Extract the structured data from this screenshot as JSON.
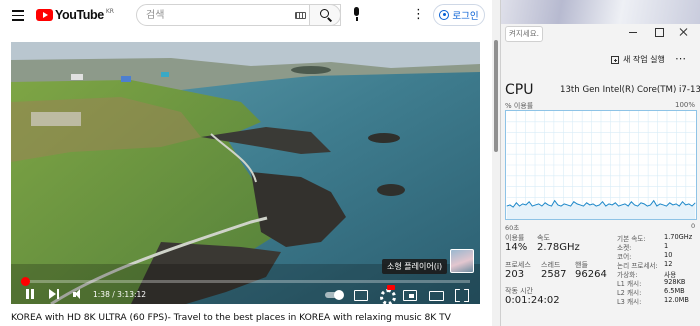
{
  "youtube": {
    "logo_text": "YouTube",
    "logo_region": "KR",
    "search_placeholder": "검색",
    "login_label": "로그인",
    "player": {
      "tooltip": "소형 플레이어(i)",
      "time": "1:38 / 3:13:12",
      "progress": 0.0085
    },
    "video_title": "KOREA with HD 8K ULTRA (60 FPS)- Travel to the best places in KOREA with relaxing music 8K TV"
  },
  "task_manager": {
    "search_placeholder": "켜지세요.",
    "new_task_label": "새 작업 실행",
    "cpu_heading": "CPU",
    "cpu_model": "13th Gen Intel(R) Core(TM) i7-135",
    "util_label": "% 이용률",
    "util_max": "100%",
    "seconds_label": "60초",
    "zero_label": "0",
    "usage_label": "이용률",
    "speed_label": "속도",
    "usage_value": "14%",
    "speed_value": "2.78GHz",
    "process_label": "프로세스",
    "thread_label": "스레드",
    "handle_label": "핸들",
    "process_value": "203",
    "thread_value": "2587",
    "handle_value": "96264",
    "uptime_label": "작동 시간",
    "uptime_value": "0:01:24:02",
    "specs": [
      {
        "label": "기본 속도:",
        "value": "1.70GHz"
      },
      {
        "label": "소켓:",
        "value": "1"
      },
      {
        "label": "코어:",
        "value": "10"
      },
      {
        "label": "논리 프로세서:",
        "value": "12"
      },
      {
        "label": "가상화:",
        "value": "사용"
      },
      {
        "label": "L1 캐시:",
        "value": "928KB"
      },
      {
        "label": "L2 캐시:",
        "value": "6.5MB"
      },
      {
        "label": "L3 캐시:",
        "value": "12.0MB"
      }
    ],
    "cpu_history": [
      12,
      13,
      11,
      15,
      12,
      14,
      13,
      16,
      12,
      13,
      14,
      12,
      15,
      13,
      12,
      17,
      13,
      12,
      14,
      13,
      12,
      16,
      14,
      13,
      12,
      15,
      13,
      14,
      12,
      13,
      16,
      12,
      14,
      13,
      15,
      12,
      13,
      14,
      12,
      16,
      13,
      12,
      15,
      14,
      12,
      13,
      17,
      12,
      14,
      13,
      12,
      15,
      13,
      14,
      12,
      16,
      13,
      14,
      12,
      15
    ],
    "graph_color": "#1a86c8"
  }
}
